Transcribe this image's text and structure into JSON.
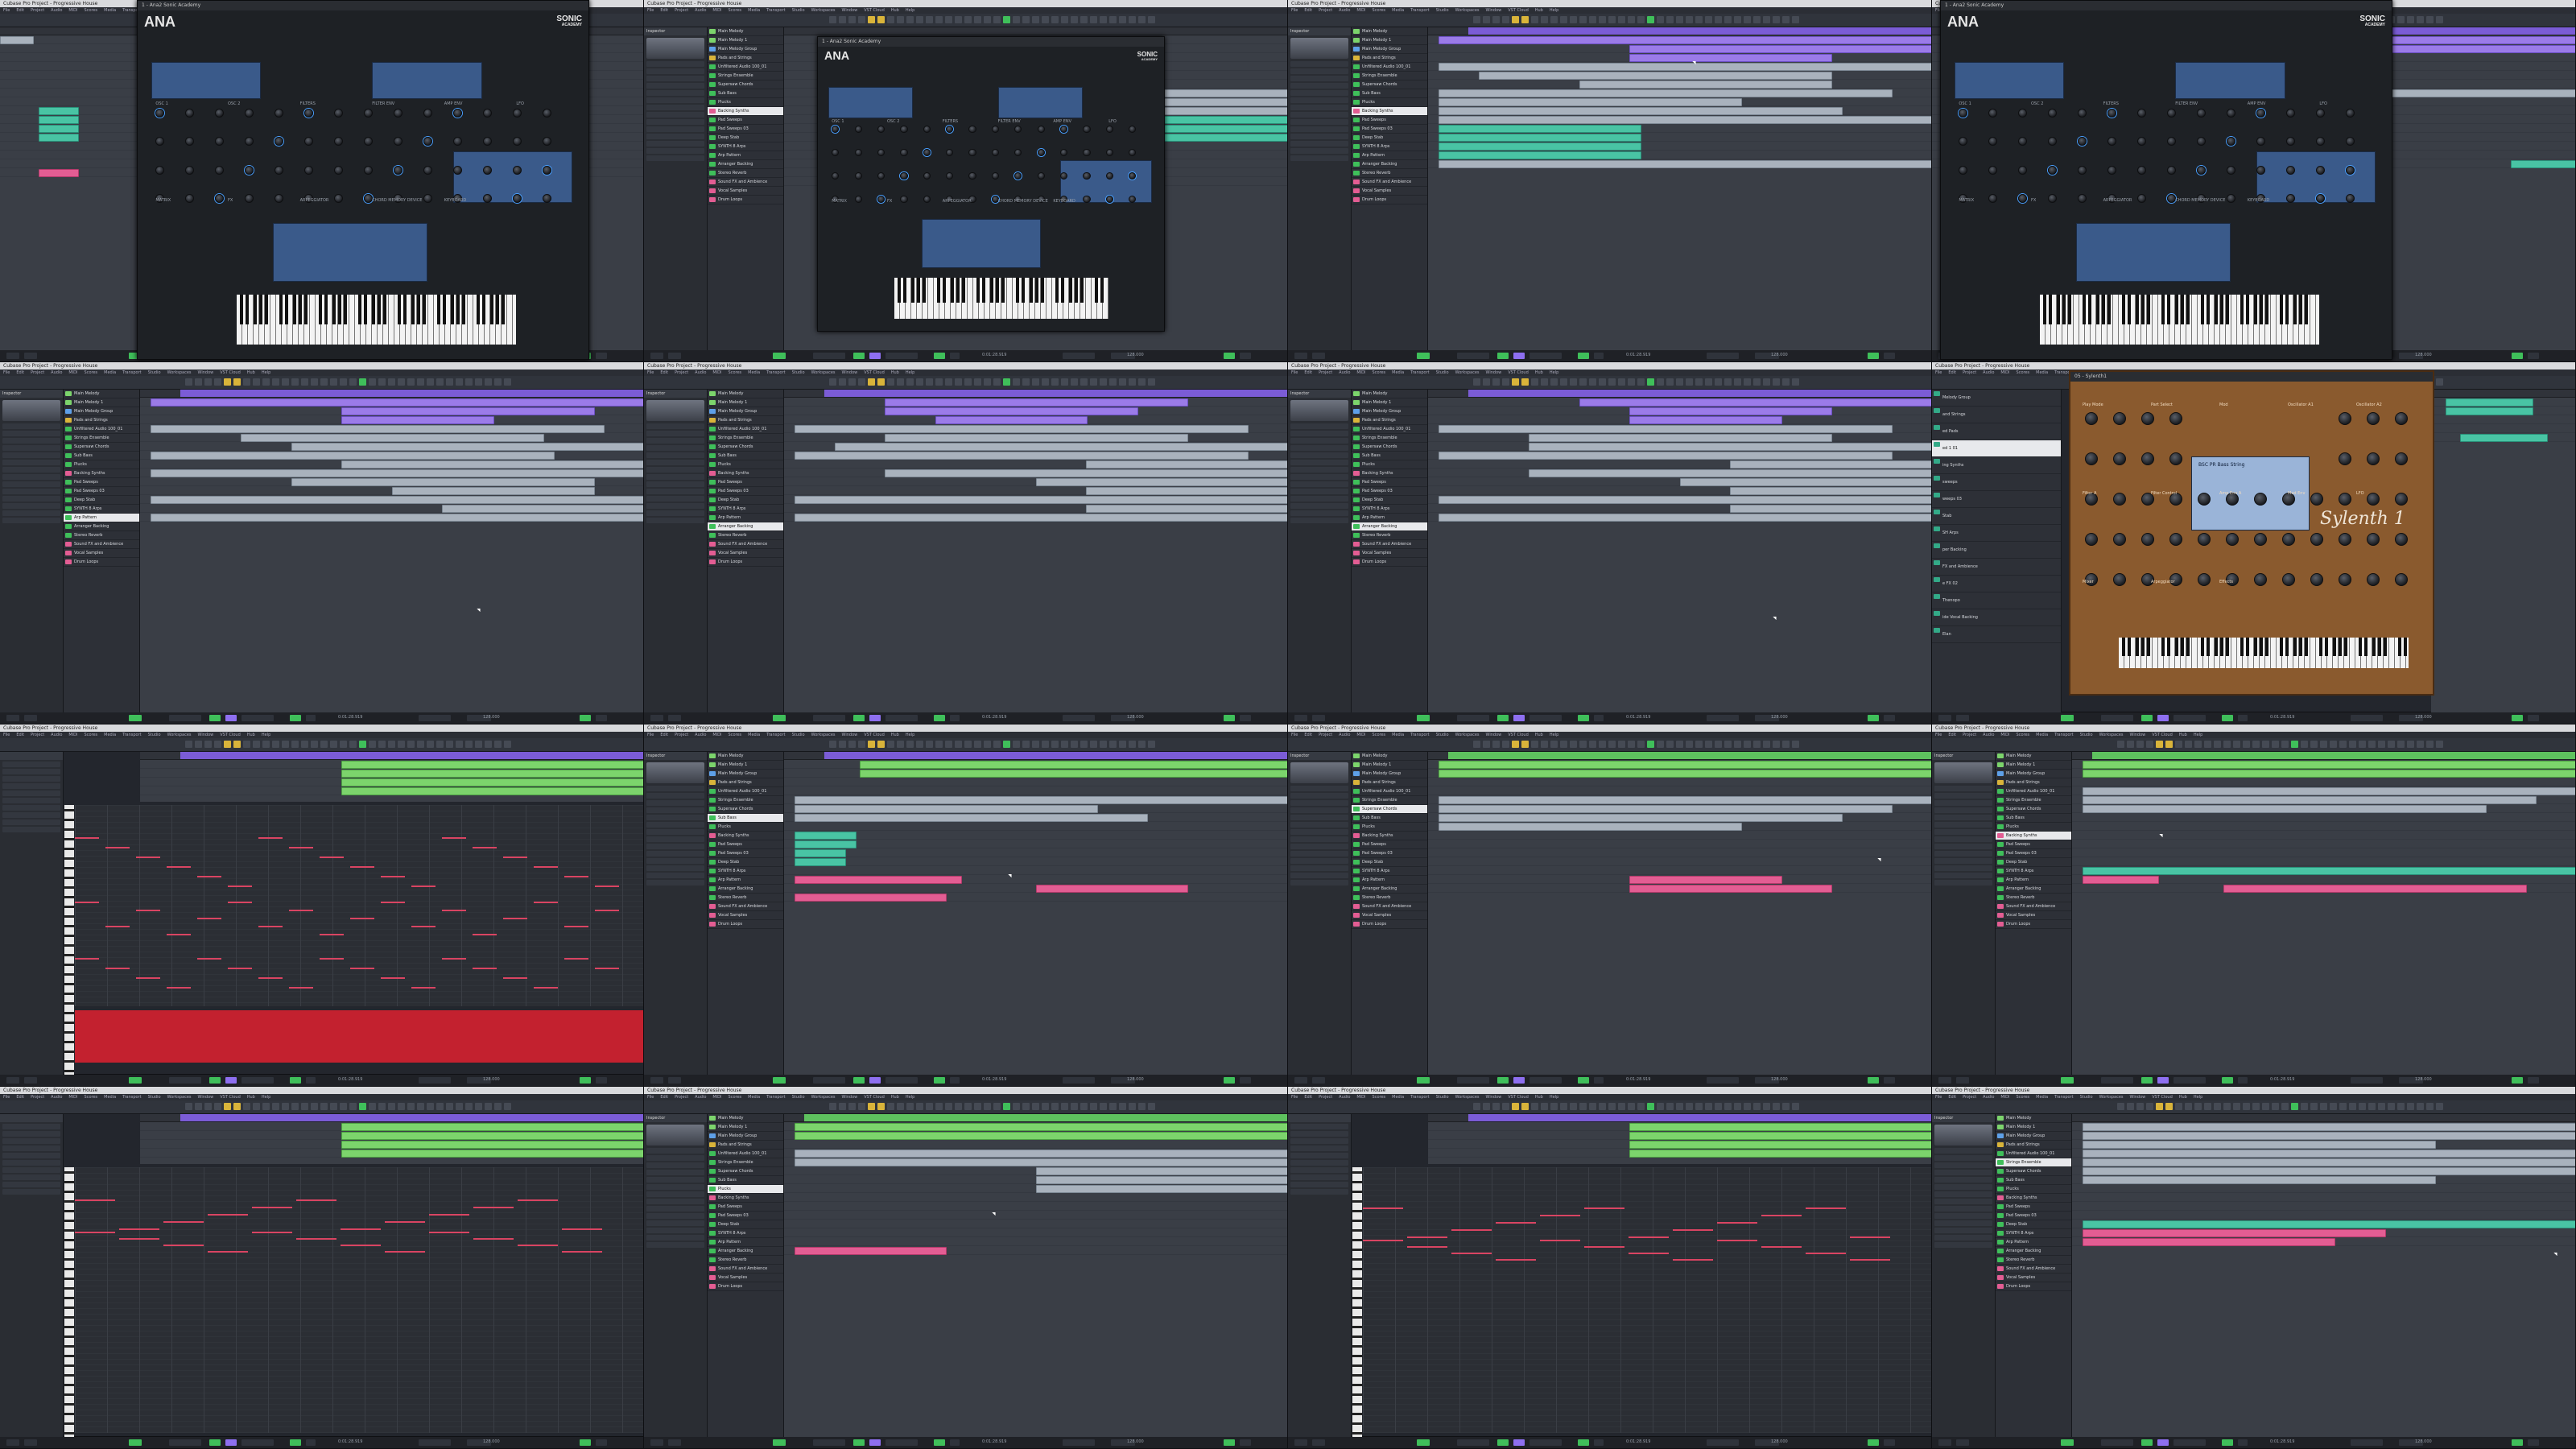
{
  "app": {
    "window_title": "Cubase Pro Project - Progressive House",
    "menu": [
      "File",
      "Edit",
      "Project",
      "Audio",
      "MIDI",
      "Scores",
      "Media",
      "Transport",
      "Studio",
      "Workspaces",
      "Window",
      "VST Cloud",
      "Hub",
      "Help"
    ],
    "inspector_label": "Inspector",
    "visibility_label": "Visibility",
    "status_no_object": "No Object Selected"
  },
  "colors": {
    "purple": "#9b7be8",
    "gray_clip": "#a9b2bd",
    "teal": "#49c4a4",
    "pink": "#e35d93",
    "green": "#7cd46c",
    "note_red": "#d94462"
  },
  "tracks": [
    {
      "name": "Main Melody",
      "color": "#7cd46c"
    },
    {
      "name": "Main Melody 1",
      "color": "#7cd46c"
    },
    {
      "name": "Main Melody Group",
      "color": "#5ea0e8"
    },
    {
      "name": "Pads and Strings",
      "color": "#d9b43a"
    },
    {
      "name": "Unfiltered Audio 100_01",
      "color": "#3fbf5a"
    },
    {
      "name": "Strings Ensemble",
      "color": "#3fbf5a"
    },
    {
      "name": "Supersaw Chords",
      "color": "#3fbf5a"
    },
    {
      "name": "Sub Bass",
      "color": "#3fbf5a"
    },
    {
      "name": "Plucks",
      "color": "#3fbf5a"
    },
    {
      "name": "Backing Synths",
      "color": "#e35d93"
    },
    {
      "name": "Pad Sweeps",
      "color": "#3fbf5a"
    },
    {
      "name": "Pad Sweeps 03",
      "color": "#3fbf5a"
    },
    {
      "name": "Deep Stab",
      "color": "#3fbf5a"
    },
    {
      "name": "SYNTH 8 Arps",
      "color": "#3fbf5a"
    },
    {
      "name": "Arp Pattern",
      "color": "#3fbf5a"
    },
    {
      "name": "Arranger Backing",
      "color": "#3fbf5a"
    },
    {
      "name": "Stereo Reverb",
      "color": "#3fbf5a"
    },
    {
      "name": "Sound FX and Ambience",
      "color": "#e35d93"
    },
    {
      "name": "Vocal Samples",
      "color": "#e35d93"
    },
    {
      "name": "Drum Loops",
      "color": "#e35d93"
    }
  ],
  "side_labels": [
    "Melody Group",
    "and Strings",
    "ed Pads",
    "ed 1 01",
    "ing Synths",
    "sweeps",
    "weeps 03",
    "Stab",
    "SH Arps",
    "per Backing",
    "FX and Ambience",
    "e FX 02",
    "Thenopo",
    "ide Vocal Backing",
    "Elan"
  ],
  "plugins": {
    "ana": {
      "logo": "ANA",
      "brand_line1": "SONIC",
      "brand_line2": "ACADEMY",
      "window_title": "1 - Ana2 Sonic Academy",
      "section_labels": [
        "OSC 1",
        "OSC 2",
        "FILTERS",
        "FILTER ENV",
        "AMP ENV",
        "LFO",
        "MATRIX",
        "FX",
        "ARPEGGIATOR",
        "CHORD MEMORY DEVICE",
        "KEYBOARD"
      ]
    },
    "sylenth": {
      "window_title": "05 - Sylenth1",
      "brand": "Sylenth 1",
      "preset": "BSC PR Bass String",
      "labels": [
        "Play Mode",
        "Part Select",
        "Mod",
        "Oscillator A1",
        "Oscillator A2",
        "Filter A",
        "Filter Control",
        "Amp Env A",
        "Mod Env",
        "LFO",
        "Mixer",
        "Arpeggiator",
        "Effects"
      ]
    }
  },
  "transport": {
    "position": "0:01:28.919",
    "tempo": "128.000",
    "signature": "4/4"
  }
}
